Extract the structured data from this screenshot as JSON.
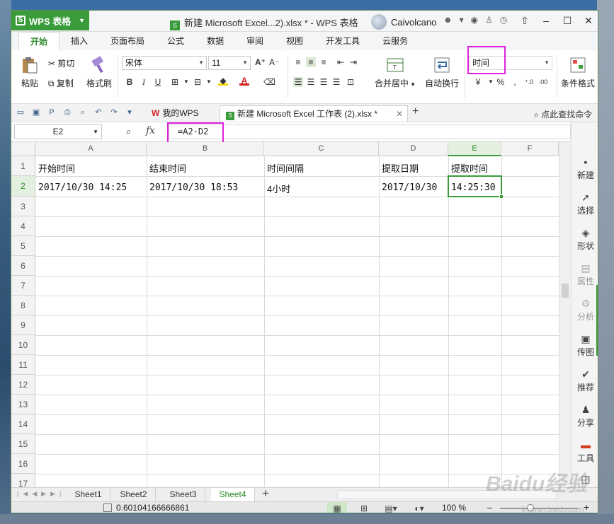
{
  "app": {
    "brand": "WPS 表格",
    "doc_title": "新建 Microsoft Excel...2).xlsx * - WPS 表格",
    "user": "Caivolcano",
    "accent": "#3a9b3a",
    "highlight": "#e020e0"
  },
  "ribbon_tabs": [
    "开始",
    "插入",
    "页面布局",
    "公式",
    "数据",
    "审阅",
    "视图",
    "开发工具",
    "云服务"
  ],
  "ribbon": {
    "paste": "粘贴",
    "cut": "剪切",
    "copy": "复制",
    "format_painter": "格式刷",
    "font_name": "宋体",
    "font_size": "11",
    "merge_center": "合并居中",
    "wrap_text": "自动换行",
    "number_format": "时间",
    "conditional_format": "条件格式"
  },
  "doc_tabs": {
    "my_wps": "我的WPS",
    "excel_tab": "新建 Microsoft Excel 工作表 (2).xlsx *",
    "command_search": "点此查找命令"
  },
  "formula_bar": {
    "name_box": "E2",
    "fx": "fx",
    "formula": "=A2-D2"
  },
  "grid": {
    "columns": [
      "A",
      "B",
      "C",
      "D",
      "E",
      "F"
    ],
    "selected_column": "E",
    "rows": [
      "1",
      "2",
      "3",
      "4",
      "5",
      "6",
      "7",
      "8",
      "9",
      "10",
      "11",
      "12",
      "13",
      "14",
      "15",
      "16",
      "17"
    ],
    "selected_row": "2",
    "cells": {
      "A1": "开始时间",
      "B1": "结束时间",
      "C1": "时间间隔",
      "D1": "提取日期",
      "E1": "提取时间",
      "A2": "2017/10/30 14:25",
      "B2": "2017/10/30 18:53",
      "C2": "4小时",
      "D2": "2017/10/30",
      "E2": "14:25:30"
    }
  },
  "task_pane": [
    "新建",
    "选择",
    "形状",
    "属性",
    "分析",
    "传图",
    "推荐",
    "分享",
    "工具",
    "备份"
  ],
  "sheets": [
    "Sheet1",
    "Sheet2",
    "Sheet3",
    "Sheet4"
  ],
  "active_sheet": "Sheet4",
  "status": {
    "sum": "0.60104166666861",
    "zoom": "100 %"
  },
  "watermark": {
    "logo": "Baidu经验",
    "url": "jingyan.baidu.com"
  }
}
